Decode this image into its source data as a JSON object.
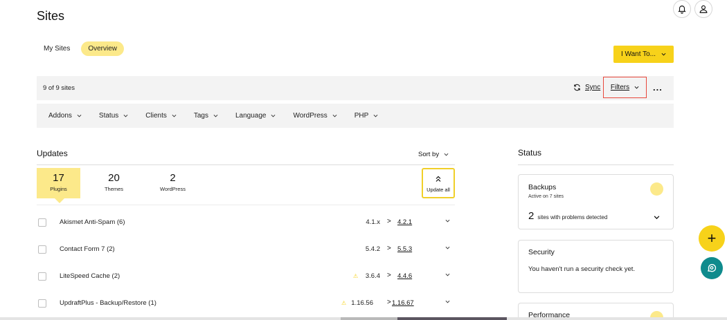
{
  "header": {
    "title": "Sites"
  },
  "tabs": [
    {
      "label": "My Sites",
      "active": false
    },
    {
      "label": "Overview",
      "active": true
    }
  ],
  "actions": {
    "i_want_to_label": "I Want To...",
    "site_count": "9 of 9 sites",
    "sync_label": "Sync",
    "filters_label": "Filters",
    "more_label": "..."
  },
  "filters": [
    "Addons",
    "Status",
    "Clients",
    "Tags",
    "Language",
    "WordPress",
    "PHP"
  ],
  "updates": {
    "title": "Updates",
    "sort_label": "Sort by",
    "stats": [
      {
        "count": "17",
        "label": "Plugins",
        "active": true
      },
      {
        "count": "20",
        "label": "Themes",
        "active": false
      },
      {
        "count": "2",
        "label": "WordPress",
        "active": false
      }
    ],
    "update_all_label": "Update all",
    "rows": [
      {
        "name": "Akismet Anti-Spam (6)",
        "current": "4.1.x",
        "arrow": ">",
        "new": "4.2.1",
        "warning": false
      },
      {
        "name": "Contact Form 7 (2)",
        "current": "5.4.2",
        "arrow": ">",
        "new": "5.5.3",
        "warning": false
      },
      {
        "name": "LiteSpeed Cache (2)",
        "current": "3.6.4",
        "arrow": ">",
        "new": "4.4.6",
        "warning": true
      },
      {
        "name": "UpdraftPlus - Backup/Restore (1)",
        "current": "1.16.56",
        "arrow": ">",
        "new": "1.16.67",
        "warning": true
      }
    ]
  },
  "status": {
    "title": "Status",
    "backups": {
      "title": "Backups",
      "subtitle": "Active on 7 sites",
      "problem_count": "2",
      "problem_text": "sites with problems detected"
    },
    "security": {
      "title": "Security",
      "message": "You haven't run a security check yet."
    },
    "performance": {
      "title": "Performance"
    }
  },
  "fab": {
    "add_symbol": "+"
  },
  "colors": {
    "accent_yellow": "#f7d21a",
    "pale_yellow": "#fce98a",
    "filters_highlight": "#e8463a",
    "chat_teal": "#0f8b8d"
  },
  "icons": {
    "notifications": "bell-icon",
    "account": "user-icon",
    "sync": "sync-icon",
    "update_all": "double-chevron-up-icon",
    "chat": "chat-icon"
  }
}
